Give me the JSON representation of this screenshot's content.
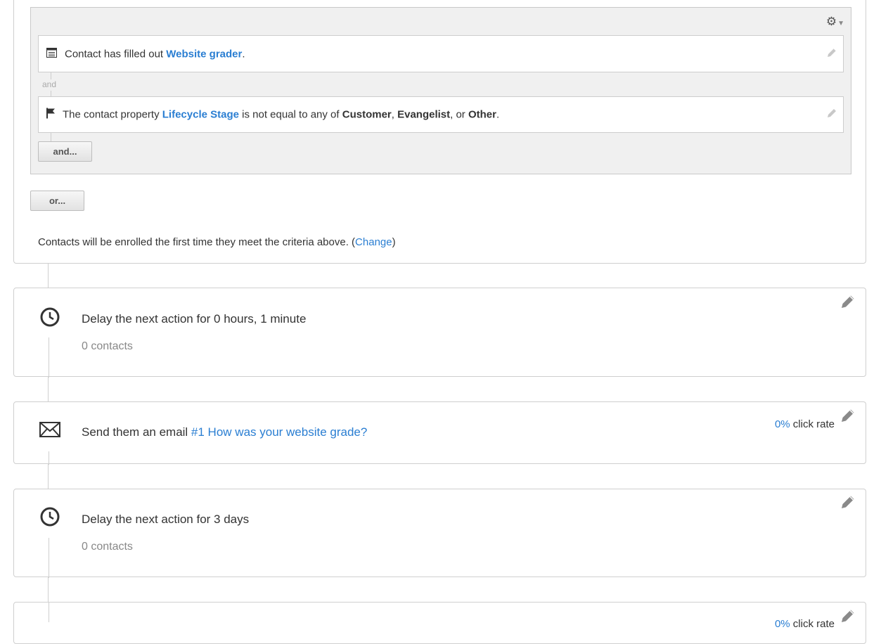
{
  "trigger": {
    "condition1": {
      "prefix": "Contact has filled out ",
      "form_link": "Website grader",
      "suffix": "."
    },
    "and_connector": "and",
    "condition2": {
      "prefix": "The contact property ",
      "property_link": "Lifecycle Stage",
      "middle": " is not equal to any of ",
      "value1": "Customer",
      "sep1": ", ",
      "value2": "Evangelist",
      "sep2": ", or ",
      "value3": "Other",
      "suffix": "."
    },
    "and_button": "and...",
    "or_button": "or...",
    "enroll_text": "Contacts will be enrolled the first time they meet the criteria above. (",
    "enroll_link": "Change",
    "enroll_close": ")"
  },
  "steps": [
    {
      "type": "delay",
      "icon": "clock-icon",
      "text": "Delay the next action for 0 hours, 1 minute",
      "contacts": "0 contacts"
    },
    {
      "type": "email",
      "icon": "envelope-icon",
      "prefix": "Send them an email ",
      "email_link": "#1 How was your website grade?",
      "rate_value": "0%",
      "rate_label": " click rate"
    },
    {
      "type": "delay",
      "icon": "clock-icon",
      "text": "Delay the next action for 3 days",
      "contacts": "0 contacts"
    },
    {
      "type": "email",
      "icon": "envelope-icon",
      "rate_value": "0%",
      "rate_label": " click rate"
    }
  ],
  "colors": {
    "link": "#2a7ed2",
    "border": "#cfcfcf",
    "group_bg": "#f0f0f0"
  }
}
